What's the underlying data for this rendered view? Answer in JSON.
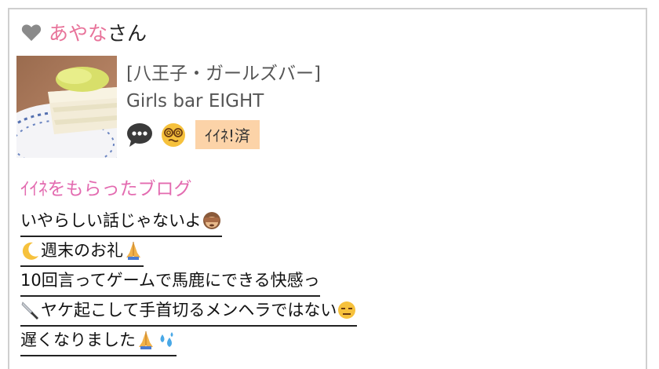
{
  "header": {
    "user_name": "あやな",
    "suffix": "さん"
  },
  "profile": {
    "shop_area": "[八王子・ガールズバー]",
    "shop_name": "Girls bar EIGHT",
    "iine_badge": "ｲｲﾈ!済"
  },
  "section_title": "ｲｲﾈをもらったブログ",
  "blogs": [
    {
      "title": "いやらしい話じゃないよ",
      "emoji": "see-no-evil-monkey"
    },
    {
      "title": "週末のお礼",
      "emoji_before": "crescent-moon",
      "emoji": "folded-hands"
    },
    {
      "title": "10回言ってゲームで馬鹿にできる快感っ"
    },
    {
      "title": " ヤケ起こして手首切るメンヘラではない",
      "emoji_before": "knife",
      "emoji": "expressionless-face"
    },
    {
      "title": "遅くなりました",
      "emoji": "folded-hands",
      "emoji2": "sweat-droplets"
    }
  ],
  "colors": {
    "user_name": "#e8739a",
    "section_title": "#e36bb0",
    "badge_bg": "#fcd3a8"
  }
}
